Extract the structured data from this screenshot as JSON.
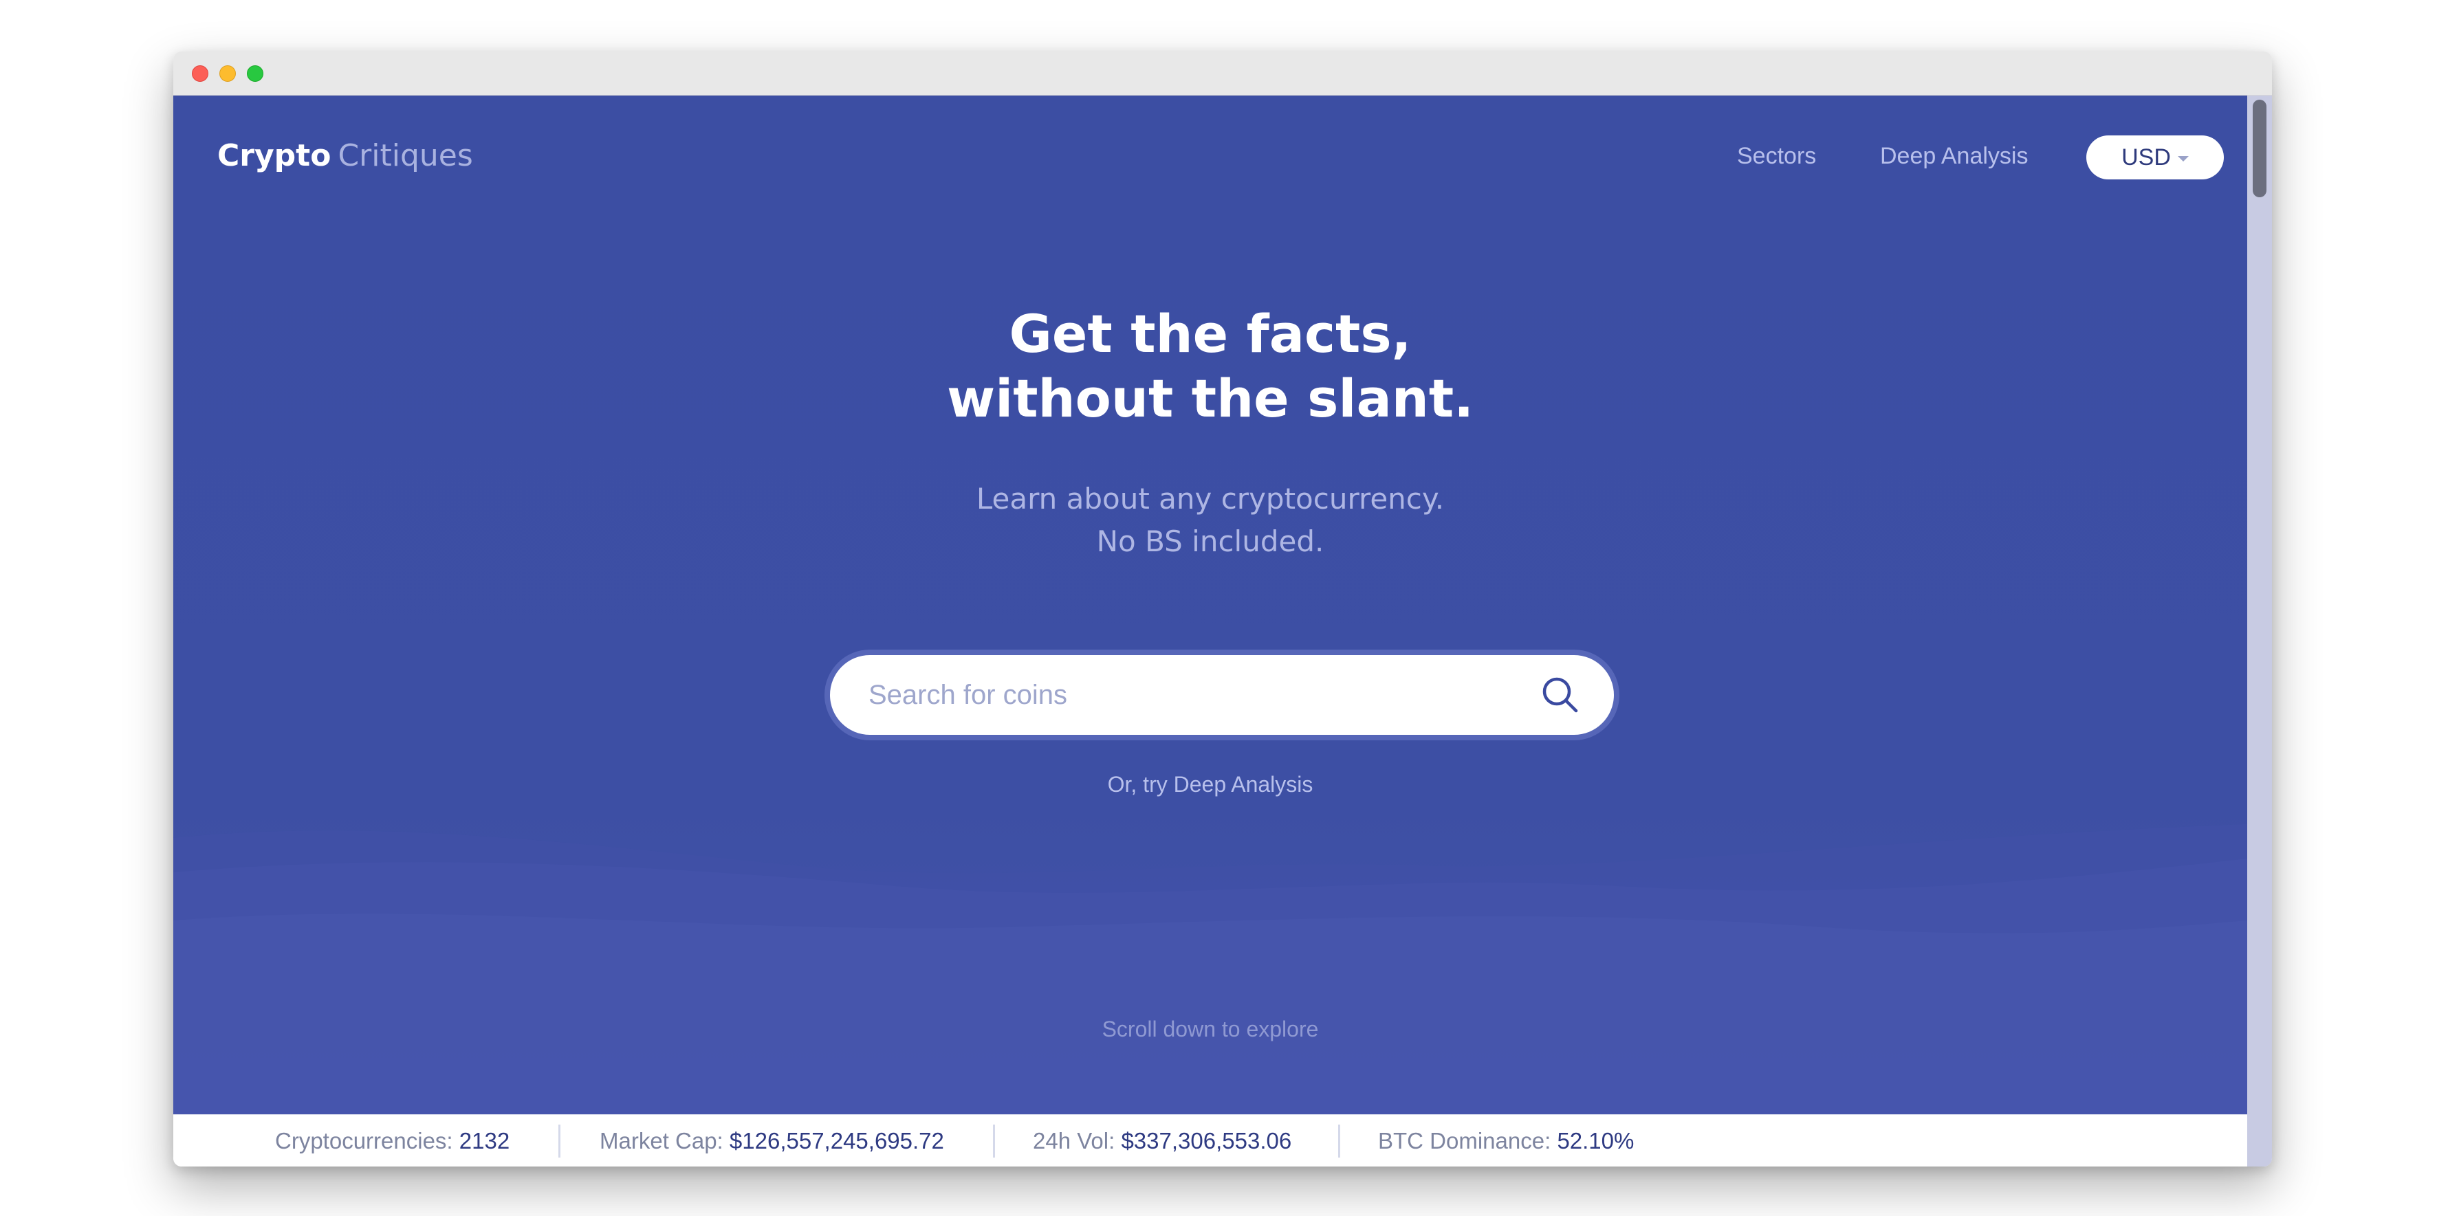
{
  "header": {
    "logo_primary": "Crypto",
    "logo_secondary": "Critiques",
    "nav": [
      {
        "label": "Sectors"
      },
      {
        "label": "Deep Analysis"
      }
    ],
    "currency": "USD"
  },
  "hero": {
    "headline_line1": "Get the facts,",
    "headline_line2": "without the slant.",
    "subhead_line1": "Learn about any cryptocurrency.",
    "subhead_line2": "No BS included.",
    "search_placeholder": "Search for coins",
    "alt_link": "Or, try Deep Analysis",
    "scroll_hint": "Scroll down to explore"
  },
  "stats": [
    {
      "label": "Cryptocurrencies:",
      "value": "2132"
    },
    {
      "label": "Market Cap:",
      "value": "$126,557,245,695.72"
    },
    {
      "label": "24h Vol:",
      "value": "$337,306,553.06"
    },
    {
      "label": "BTC Dominance:",
      "value": "52.10%"
    }
  ],
  "icons": {
    "search": "search-icon",
    "currency_caret": "chevron-down-icon"
  },
  "colors": {
    "hero_background": "#3d4fa4",
    "accent_text": "#2e3a82",
    "muted_nav": "#b8c0ec"
  }
}
